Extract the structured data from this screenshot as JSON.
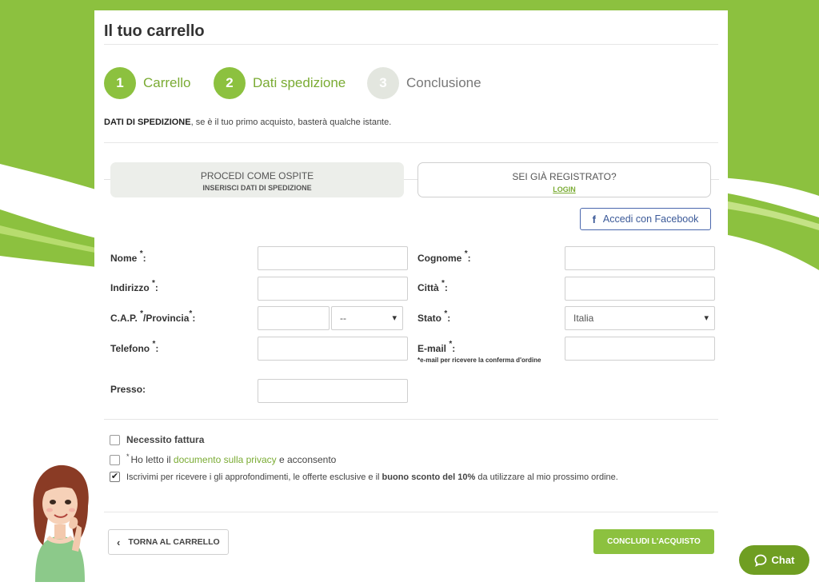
{
  "page_title": "Il tuo carrello",
  "steps": [
    {
      "number": "1",
      "label": "Carrello",
      "state": "active"
    },
    {
      "number": "2",
      "label": "Dati spedizione",
      "state": "active"
    },
    {
      "number": "3",
      "label": "Conclusione",
      "state": "inactive"
    }
  ],
  "intro": {
    "strong": "DATI DI SPEDIZIONE",
    "rest": ", se è il tuo primo acquisto, basterà qualche istante."
  },
  "options": {
    "guest_title": "PROCEDI COME OSPITE",
    "guest_sub": "INSERISCI DATI DI SPEDIZIONE",
    "login_title": "SEI GIÀ REGISTRATO?",
    "login_link": "LOGIN"
  },
  "facebook": {
    "label": "Accedi con Facebook",
    "icon": "facebook-icon"
  },
  "form": {
    "nome_label": "Nome",
    "cognome_label": "Cognome",
    "indirizzo_label": "Indirizzo",
    "citta_label": "Città",
    "cap_label": "C.A.P.",
    "provincia_label": "/Provincia",
    "provincia_value": "--",
    "stato_label": "Stato",
    "stato_value": "Italia",
    "telefono_label": "Telefono",
    "email_label": "E-mail",
    "email_hint": "*e-mail per ricevere la conferma d'ordine",
    "presso_label": "Presso:",
    "required_mark": "*",
    "colon": ":"
  },
  "checks": {
    "invoice": {
      "label": "Necessito fattura",
      "checked": false
    },
    "privacy": {
      "pre": "Ho letto il ",
      "link": "documento sulla privacy",
      "post": " e acconsento",
      "checked": false
    },
    "newsletter": {
      "pre": "Iscrivimi per ricevere i gli approfondimenti, le offerte esclusive e il ",
      "strong": "buono sconto del 10%",
      "post": " da utilizzare al mio prossimo ordine.",
      "checked": true
    }
  },
  "buttons": {
    "back": "TORNA AL CARRELLO",
    "confirm": "CONCLUDI L'ACQUISTO",
    "chat": "Chat"
  },
  "colors": {
    "accent": "#8cc13f",
    "accent_dark": "#6f9e22",
    "facebook": "#3b5998"
  }
}
